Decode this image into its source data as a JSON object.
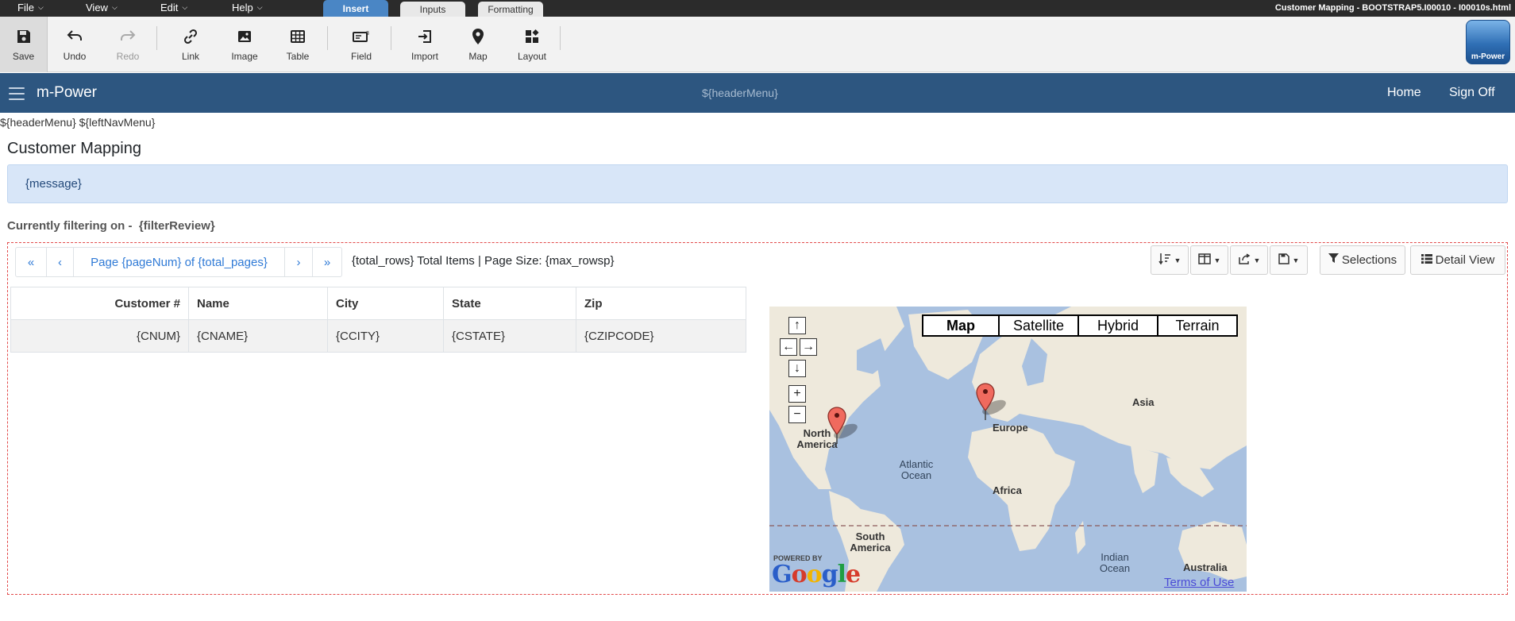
{
  "menubar": {
    "menus": [
      {
        "label": "File"
      },
      {
        "label": "View"
      },
      {
        "label": "Edit"
      },
      {
        "label": "Help"
      }
    ],
    "tabs": [
      {
        "label": "Insert"
      },
      {
        "label": "Inputs"
      },
      {
        "label": "Formatting"
      }
    ],
    "window_title": "Customer Mapping - BOOTSTRAP5.I00010 - I00010s.html"
  },
  "toolbar": {
    "save": "Save",
    "undo": "Undo",
    "redo": "Redo",
    "link": "Link",
    "image": "Image",
    "table": "Table",
    "field": "Field",
    "import": "Import",
    "map": "Map",
    "layout": "Layout",
    "logo_text": "m-Power"
  },
  "appbar": {
    "brand": "m-Power",
    "header_menu": "${headerMenu}",
    "home": "Home",
    "sign_off": "Sign Off"
  },
  "template_line": "${headerMenu} ${leftNavMenu}",
  "page_title": "Customer Mapping",
  "message": "{message}",
  "filter": {
    "label": "Currently filtering on -",
    "value": "{filterReview}"
  },
  "pager": {
    "first": "«",
    "prev": "‹",
    "page": "Page {pageNum} of {total_pages}",
    "next": "›",
    "last": "»",
    "totals": "{total_rows} Total Items | Page Size: {max_rowsp}"
  },
  "buttons": {
    "selections": "Selections",
    "detail_view": "Detail View"
  },
  "table": {
    "headers": [
      "Customer #",
      "Name",
      "City",
      "State",
      "Zip"
    ],
    "row": [
      "{CNUM}",
      "{CNAME}",
      "{CCITY}",
      "{CSTATE}",
      "{CZIPCODE}"
    ]
  },
  "map": {
    "types": [
      "Map",
      "Satellite",
      "Hybrid",
      "Terrain"
    ],
    "active_type": "Map",
    "labels": {
      "north_america": "North America",
      "europe": "Europe",
      "asia": "Asia",
      "atlantic": "Atlantic Ocean",
      "africa": "Africa",
      "south_america": "South America",
      "indian": "Indian Ocean",
      "australia": "Australia"
    },
    "powered_by": "POWERED BY",
    "google": "Google",
    "terms": "Terms of Use"
  }
}
